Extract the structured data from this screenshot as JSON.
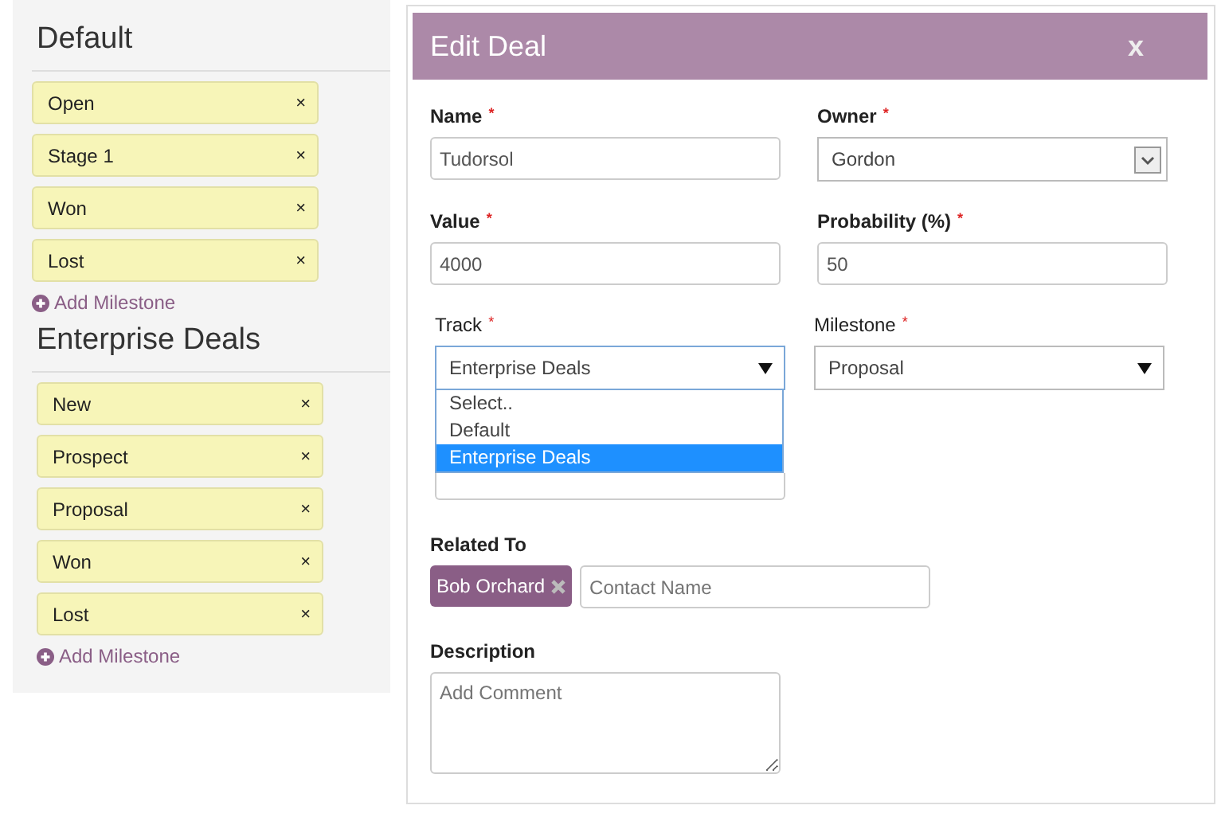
{
  "pipelines": [
    {
      "title": "Default",
      "milestones": [
        {
          "name": "Open",
          "remove": "×"
        },
        {
          "name": "Stage 1",
          "remove": "×"
        },
        {
          "name": "Won",
          "remove": "×"
        },
        {
          "name": "Lost",
          "remove": "×"
        }
      ],
      "add_link": "Add Milestone"
    },
    {
      "title": "Enterprise Deals",
      "milestones": [
        {
          "name": "New",
          "remove": "×"
        },
        {
          "name": "Prospect",
          "remove": "×"
        },
        {
          "name": "Proposal",
          "remove": "×"
        },
        {
          "name": "Won",
          "remove": "×"
        },
        {
          "name": "Lost",
          "remove": "×"
        }
      ],
      "add_link": "Add Milestone"
    }
  ],
  "dialog": {
    "title": "Edit Deal",
    "close": "x",
    "name": {
      "label": "Name",
      "mark": "*",
      "value": "Tudorsol"
    },
    "owner": {
      "label": "Owner",
      "mark": "*",
      "value": "Gordon"
    },
    "value": {
      "label": "Value",
      "mark": "*",
      "value": "4000"
    },
    "probability": {
      "label": "Probability (%)",
      "mark": "*",
      "value": "50"
    },
    "track": {
      "label": "Track",
      "mark": "*",
      "value": "Enterprise Deals",
      "expanded": true,
      "options": [
        {
          "label": "Select..",
          "selected": false
        },
        {
          "label": "Default",
          "selected": false
        },
        {
          "label": "Enterprise Deals",
          "selected": true
        }
      ]
    },
    "milestone": {
      "label": "Milestone",
      "mark": "*",
      "value": "Proposal"
    },
    "related_to": {
      "label": "Related To",
      "tags": [
        {
          "name": "Bob Orchard"
        }
      ],
      "placeholder": "Contact Name"
    },
    "description": {
      "label": "Description",
      "placeholder": "Add Comment"
    }
  }
}
